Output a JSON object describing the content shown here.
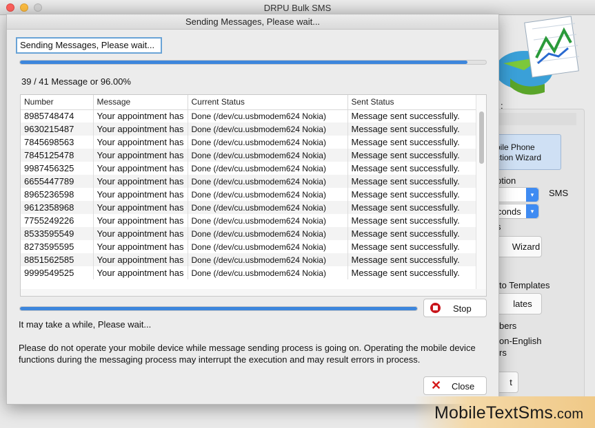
{
  "window": {
    "title": "DRPU Bulk SMS"
  },
  "background": {
    "texts": [
      ":",
      "bile Phone",
      "ction  Wizard",
      "ption",
      "SMS",
      "conds",
      "s",
      "Wizard",
      "to Templates",
      "lates",
      "bers",
      "on-English",
      "rs",
      "t"
    ]
  },
  "dialog": {
    "title": "Sending Messages, Please wait...",
    "status_box": "Sending Messages, Please wait...",
    "top_progress": 0.96,
    "count_label": "39 / 41 Message or 96.00%",
    "bottom_progress": 1.0,
    "wait_text": "It may take a while, Please wait...",
    "info_text": "Please do not operate your mobile device while message sending process is going on. Operating the mobile device functions during the messaging process may interrupt the execution and may result errors in process.",
    "stop_label": "Stop",
    "close_label": "Close"
  },
  "table": {
    "headers": [
      "Number",
      "Message",
      "Current Status",
      "Sent Status"
    ],
    "rows": [
      [
        "8985748474",
        "Your appointment has",
        "Done (/dev/cu.usbmodem624 Nokia)",
        "Message sent successfully."
      ],
      [
        "9630215487",
        "Your appointment has",
        "Done (/dev/cu.usbmodem624 Nokia)",
        "Message sent successfully."
      ],
      [
        "7845698563",
        "Your appointment has",
        "Done (/dev/cu.usbmodem624 Nokia)",
        "Message sent successfully."
      ],
      [
        "7845125478",
        "Your appointment has",
        "Done (/dev/cu.usbmodem624 Nokia)",
        "Message sent successfully."
      ],
      [
        "9987456325",
        "Your appointment has",
        "Done (/dev/cu.usbmodem624 Nokia)",
        "Message sent successfully."
      ],
      [
        "6655447789",
        "Your appointment has",
        "Done (/dev/cu.usbmodem624 Nokia)",
        "Message sent successfully."
      ],
      [
        "8965236598",
        "Your appointment has",
        "Done (/dev/cu.usbmodem624 Nokia)",
        "Message sent successfully."
      ],
      [
        "9612358968",
        "Your appointment has",
        "Done (/dev/cu.usbmodem624 Nokia)",
        "Message sent successfully."
      ],
      [
        "7755249226",
        "Your appointment has",
        "Done (/dev/cu.usbmodem624 Nokia)",
        "Message sent successfully."
      ],
      [
        "8533595549",
        "Your appointment has",
        "Done (/dev/cu.usbmodem624 Nokia)",
        "Message sent successfully."
      ],
      [
        "8273595595",
        "Your appointment has",
        "Done (/dev/cu.usbmodem624 Nokia)",
        "Message sent successfully."
      ],
      [
        "8851562585",
        "Your appointment has",
        "Done (/dev/cu.usbmodem624 Nokia)",
        "Message sent successfully."
      ],
      [
        "9999549525",
        "Your appointment has",
        "Done (/dev/cu.usbmodem624 Nokia)",
        "Message sent successfully."
      ]
    ]
  },
  "watermark": {
    "text": "MobileTextSms",
    "suffix": ".com"
  },
  "colors": {
    "accent": "#3d86dc",
    "stop_red": "#c8151b",
    "close_red": "#d51a1a"
  }
}
